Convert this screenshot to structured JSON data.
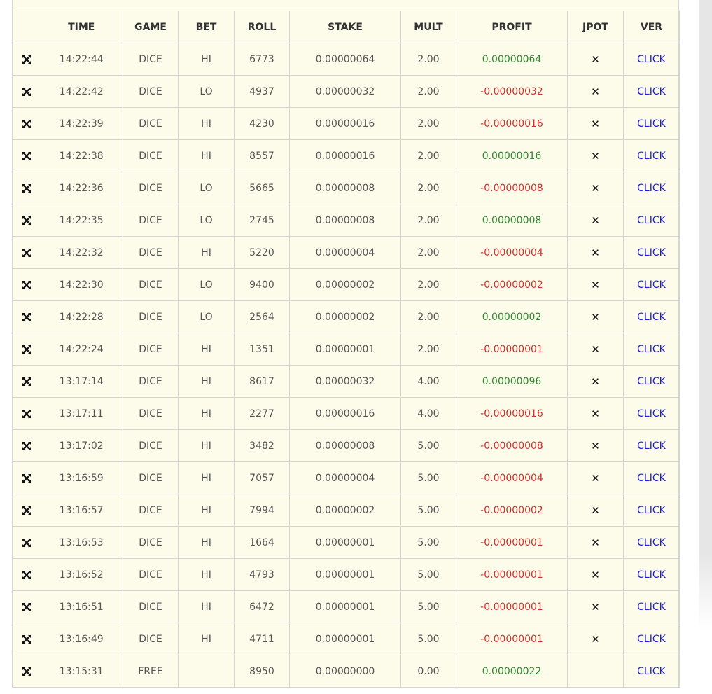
{
  "colors": {
    "panel_bg": "#fdfcea",
    "profit_positive": "#2f8a2f",
    "profit_negative": "#d62d2d",
    "link": "#1a1aee"
  },
  "table": {
    "headers": [
      "",
      "TIME",
      "GAME",
      "BET",
      "ROLL",
      "STAKE",
      "MULT",
      "PROFIT",
      "JPOT",
      "VER"
    ],
    "rows": [
      {
        "icon": "expand-icon",
        "time": "14:22:44",
        "game": "DICE",
        "bet": "HI",
        "roll": "6773",
        "stake": "0.00000064",
        "mult": "2.00",
        "profit": "0.00000064",
        "jpot": "✕",
        "ver": "CLICK"
      },
      {
        "icon": "expand-icon",
        "time": "14:22:42",
        "game": "DICE",
        "bet": "LO",
        "roll": "4937",
        "stake": "0.00000032",
        "mult": "2.00",
        "profit": "-0.00000032",
        "jpot": "✕",
        "ver": "CLICK"
      },
      {
        "icon": "expand-icon",
        "time": "14:22:39",
        "game": "DICE",
        "bet": "HI",
        "roll": "4230",
        "stake": "0.00000016",
        "mult": "2.00",
        "profit": "-0.00000016",
        "jpot": "✕",
        "ver": "CLICK"
      },
      {
        "icon": "expand-icon",
        "time": "14:22:38",
        "game": "DICE",
        "bet": "HI",
        "roll": "8557",
        "stake": "0.00000016",
        "mult": "2.00",
        "profit": "0.00000016",
        "jpot": "✕",
        "ver": "CLICK"
      },
      {
        "icon": "expand-icon",
        "time": "14:22:36",
        "game": "DICE",
        "bet": "LO",
        "roll": "5665",
        "stake": "0.00000008",
        "mult": "2.00",
        "profit": "-0.00000008",
        "jpot": "✕",
        "ver": "CLICK"
      },
      {
        "icon": "expand-icon",
        "time": "14:22:35",
        "game": "DICE",
        "bet": "LO",
        "roll": "2745",
        "stake": "0.00000008",
        "mult": "2.00",
        "profit": "0.00000008",
        "jpot": "✕",
        "ver": "CLICK"
      },
      {
        "icon": "expand-icon",
        "time": "14:22:32",
        "game": "DICE",
        "bet": "HI",
        "roll": "5220",
        "stake": "0.00000004",
        "mult": "2.00",
        "profit": "-0.00000004",
        "jpot": "✕",
        "ver": "CLICK"
      },
      {
        "icon": "expand-icon",
        "time": "14:22:30",
        "game": "DICE",
        "bet": "LO",
        "roll": "9400",
        "stake": "0.00000002",
        "mult": "2.00",
        "profit": "-0.00000002",
        "jpot": "✕",
        "ver": "CLICK"
      },
      {
        "icon": "expand-icon",
        "time": "14:22:28",
        "game": "DICE",
        "bet": "LO",
        "roll": "2564",
        "stake": "0.00000002",
        "mult": "2.00",
        "profit": "0.00000002",
        "jpot": "✕",
        "ver": "CLICK"
      },
      {
        "icon": "expand-icon",
        "time": "14:22:24",
        "game": "DICE",
        "bet": "HI",
        "roll": "1351",
        "stake": "0.00000001",
        "mult": "2.00",
        "profit": "-0.00000001",
        "jpot": "✕",
        "ver": "CLICK"
      },
      {
        "icon": "expand-icon",
        "time": "13:17:14",
        "game": "DICE",
        "bet": "HI",
        "roll": "8617",
        "stake": "0.00000032",
        "mult": "4.00",
        "profit": "0.00000096",
        "jpot": "✕",
        "ver": "CLICK"
      },
      {
        "icon": "expand-icon",
        "time": "13:17:11",
        "game": "DICE",
        "bet": "HI",
        "roll": "2277",
        "stake": "0.00000016",
        "mult": "4.00",
        "profit": "-0.00000016",
        "jpot": "✕",
        "ver": "CLICK"
      },
      {
        "icon": "expand-icon",
        "time": "13:17:02",
        "game": "DICE",
        "bet": "HI",
        "roll": "3482",
        "stake": "0.00000008",
        "mult": "5.00",
        "profit": "-0.00000008",
        "jpot": "✕",
        "ver": "CLICK"
      },
      {
        "icon": "expand-icon",
        "time": "13:16:59",
        "game": "DICE",
        "bet": "HI",
        "roll": "7057",
        "stake": "0.00000004",
        "mult": "5.00",
        "profit": "-0.00000004",
        "jpot": "✕",
        "ver": "CLICK"
      },
      {
        "icon": "expand-icon",
        "time": "13:16:57",
        "game": "DICE",
        "bet": "HI",
        "roll": "7994",
        "stake": "0.00000002",
        "mult": "5.00",
        "profit": "-0.00000002",
        "jpot": "✕",
        "ver": "CLICK"
      },
      {
        "icon": "expand-icon",
        "time": "13:16:53",
        "game": "DICE",
        "bet": "HI",
        "roll": "1664",
        "stake": "0.00000001",
        "mult": "5.00",
        "profit": "-0.00000001",
        "jpot": "✕",
        "ver": "CLICK"
      },
      {
        "icon": "expand-icon",
        "time": "13:16:52",
        "game": "DICE",
        "bet": "HI",
        "roll": "4793",
        "stake": "0.00000001",
        "mult": "5.00",
        "profit": "-0.00000001",
        "jpot": "✕",
        "ver": "CLICK"
      },
      {
        "icon": "expand-icon",
        "time": "13:16:51",
        "game": "DICE",
        "bet": "HI",
        "roll": "6472",
        "stake": "0.00000001",
        "mult": "5.00",
        "profit": "-0.00000001",
        "jpot": "✕",
        "ver": "CLICK"
      },
      {
        "icon": "expand-icon",
        "time": "13:16:49",
        "game": "DICE",
        "bet": "HI",
        "roll": "4711",
        "stake": "0.00000001",
        "mult": "5.00",
        "profit": "-0.00000001",
        "jpot": "✕",
        "ver": "CLICK"
      },
      {
        "icon": "expand-icon",
        "time": "13:15:31",
        "game": "FREE",
        "bet": "",
        "roll": "8950",
        "stake": "0.00000000",
        "mult": "0.00",
        "profit": "0.00000022",
        "jpot": "",
        "ver": "CLICK"
      }
    ]
  }
}
